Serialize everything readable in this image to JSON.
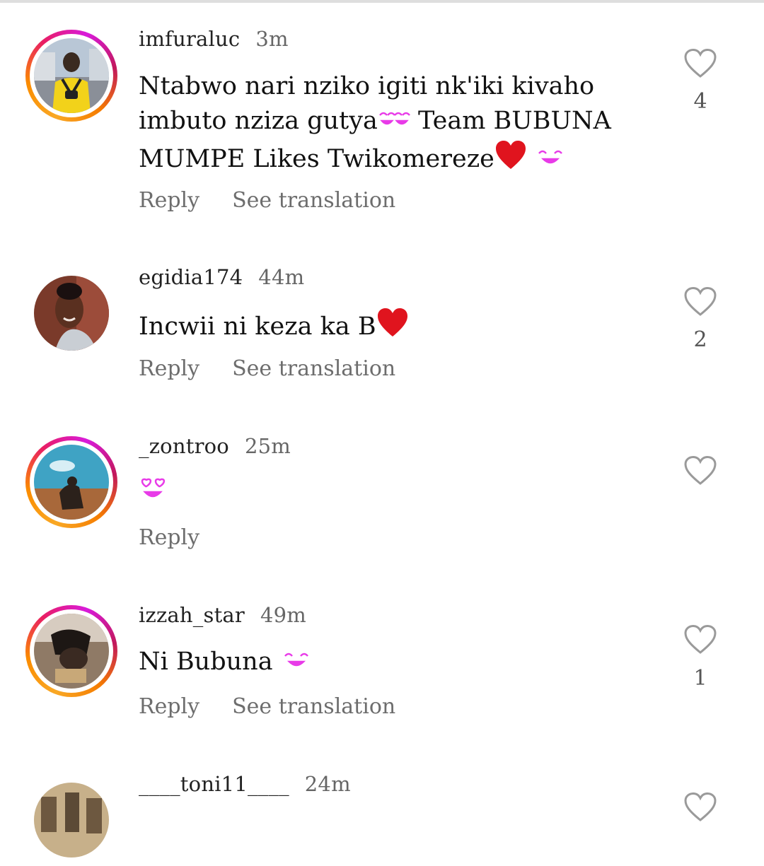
{
  "comments": [
    {
      "username": "imfuraluc",
      "time": "3m",
      "text": "Ntabwo nari nziko igiti nk'iki kivaho imbuto nziza gutya🥰🥰 Team BUBUNA MUMPE Likes Twikomereze❤️🥰",
      "reply_label": "Reply",
      "translate_label": "See translation",
      "likes": "4",
      "has_story_ring": true
    },
    {
      "username": "egidia174",
      "time": "44m",
      "text": "Incwii ni keza ka B❤️",
      "reply_label": "Reply",
      "translate_label": "See translation",
      "likes": "2",
      "has_story_ring": false
    },
    {
      "username": "_zontroo",
      "time": "25m",
      "text": "😍",
      "reply_label": "Reply",
      "translate_label": "",
      "likes": "",
      "has_story_ring": true
    },
    {
      "username": "izzah_star",
      "time": "49m",
      "text": "Ni Bubuna 🥰",
      "reply_label": "Reply",
      "translate_label": "See translation",
      "likes": "1",
      "has_story_ring": true
    },
    {
      "username": "____toni11____",
      "time": "24m",
      "text": "",
      "reply_label": "",
      "translate_label": "",
      "likes": "",
      "has_story_ring": false
    }
  ],
  "icons": {
    "like": "heart-outline-icon"
  },
  "colors": {
    "ring_gradient": [
      "#f9a825",
      "#e91e63",
      "#d81bdb"
    ],
    "heart_red": "#e0141e",
    "emoji_pink": "#e83be8",
    "secondary_text": "#6d6d6d"
  }
}
